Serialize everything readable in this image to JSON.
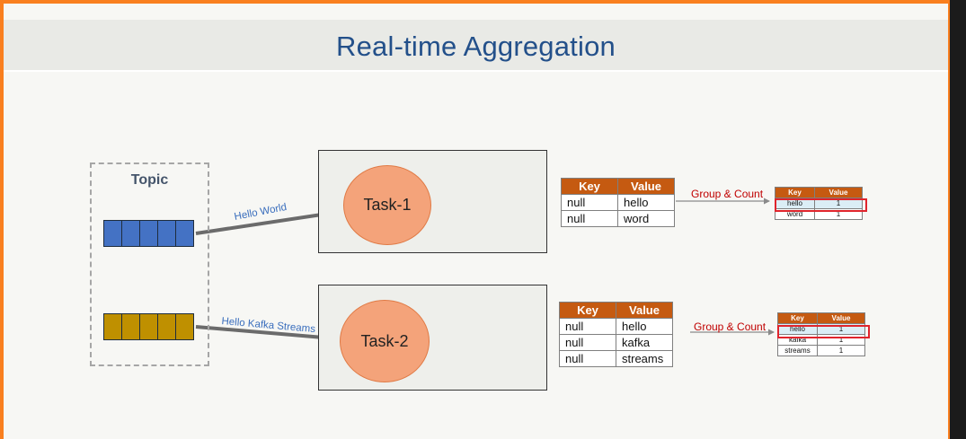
{
  "title": "Real-time Aggregation",
  "topic": {
    "label": "Topic",
    "partition_count": 2,
    "cells_per_partition": 5
  },
  "colors": {
    "partition_1": "#4472c4",
    "partition_2": "#bf9000",
    "task_circle": "#f4a37a",
    "table_header": "#c55a11",
    "highlight_border": "#e0242c",
    "title_text": "#23508a"
  },
  "flows": [
    {
      "label": "Hello World"
    },
    {
      "label": "Hello Kafka Streams"
    }
  ],
  "tasks": [
    {
      "label": "Task-1",
      "store_icon": "state-store-icon"
    },
    {
      "label": "Task-2",
      "store_icon": "state-store-icon"
    }
  ],
  "input_tables": [
    {
      "headers": [
        "Key",
        "Value"
      ],
      "rows": [
        [
          "null",
          "hello"
        ],
        [
          "null",
          "word"
        ]
      ]
    },
    {
      "headers": [
        "Key",
        "Value"
      ],
      "rows": [
        [
          "null",
          "hello"
        ],
        [
          "null",
          "kafka"
        ],
        [
          "null",
          "streams"
        ]
      ]
    }
  ],
  "operation_label": "Group & Count",
  "result_tables": [
    {
      "headers": [
        "Key",
        "Value"
      ],
      "rows": [
        [
          "hello",
          "1"
        ],
        [
          "word",
          "1"
        ]
      ],
      "highlighted_row": 0
    },
    {
      "headers": [
        "Key",
        "Value"
      ],
      "rows": [
        [
          "hello",
          "1"
        ],
        [
          "kafka",
          "1"
        ],
        [
          "streams",
          "1"
        ]
      ],
      "highlighted_row": 0
    }
  ]
}
